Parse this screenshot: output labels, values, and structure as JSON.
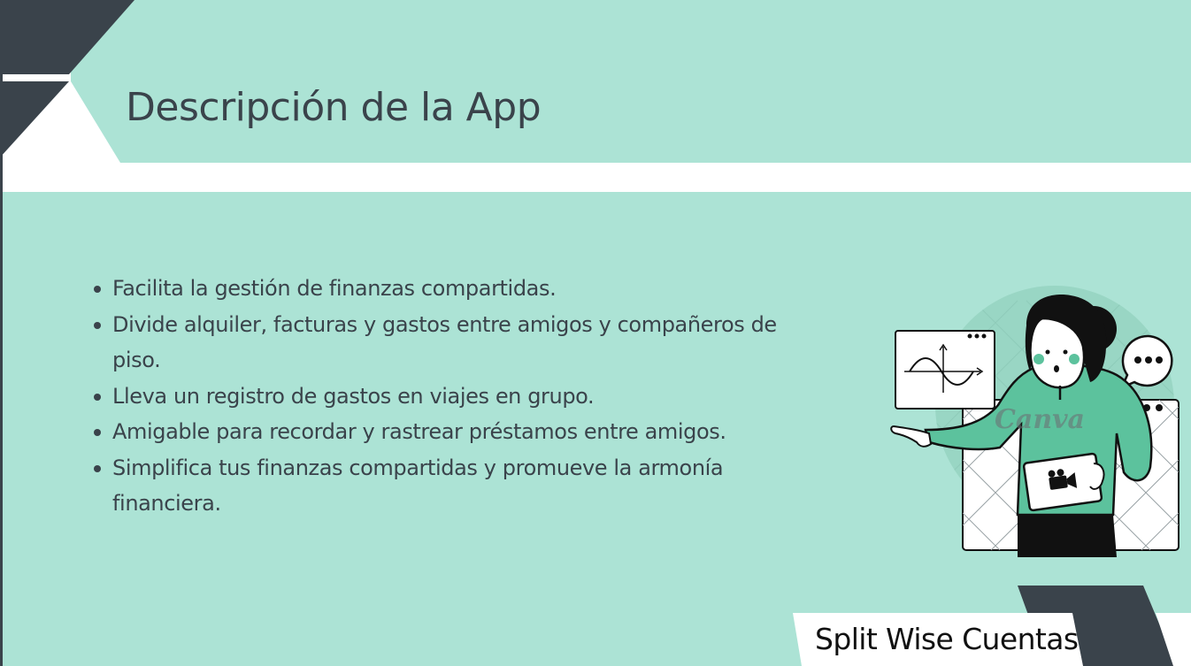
{
  "slide": {
    "title": "Descripción de la App",
    "bullets": [
      "Facilita la gestión de finanzas compartidas.",
      "Divide alquiler, facturas y gastos entre amigos y compañeros de piso.",
      "Lleva un registro de gastos en viajes en grupo.",
      "Amigable para recordar y rastrear préstamos entre amigos.",
      "Simplifica tus finanzas compartidas y promueve la armonía financiera."
    ],
    "footer": "Split Wise Cuentas"
  },
  "illustration": {
    "name": "woman-presenting-illustration",
    "watermark": "Canva"
  },
  "colors": {
    "mint": "#ace3d5",
    "dark": "#3a434b",
    "accent_green": "#5cc29d",
    "white": "#ffffff"
  }
}
